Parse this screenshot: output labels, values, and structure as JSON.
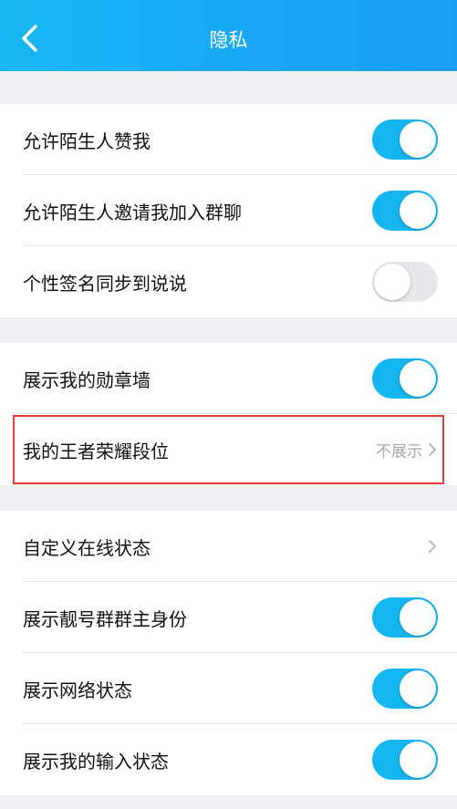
{
  "header": {
    "title": "隐私",
    "back_icon": "chevron-left-icon"
  },
  "group1": [
    {
      "label": "允许陌生人赞我",
      "toggle": true
    },
    {
      "label": "允许陌生人邀请我加入群聊",
      "toggle": true
    },
    {
      "label": "个性签名同步到说说",
      "toggle": false
    }
  ],
  "group2": [
    {
      "label": "展示我的勋章墙",
      "toggle": true
    },
    {
      "label": "我的王者荣耀段位",
      "value": "不展示",
      "highlighted": true
    }
  ],
  "group3": [
    {
      "label": "自定义在线状态"
    },
    {
      "label": "展示靓号群群主身份",
      "toggle": true
    },
    {
      "label": "展示网络状态",
      "toggle": true
    },
    {
      "label": "展示我的输入状态",
      "toggle": true
    }
  ],
  "colors": {
    "accent": "#14b6f2",
    "highlight_border": "#e43b3b"
  }
}
